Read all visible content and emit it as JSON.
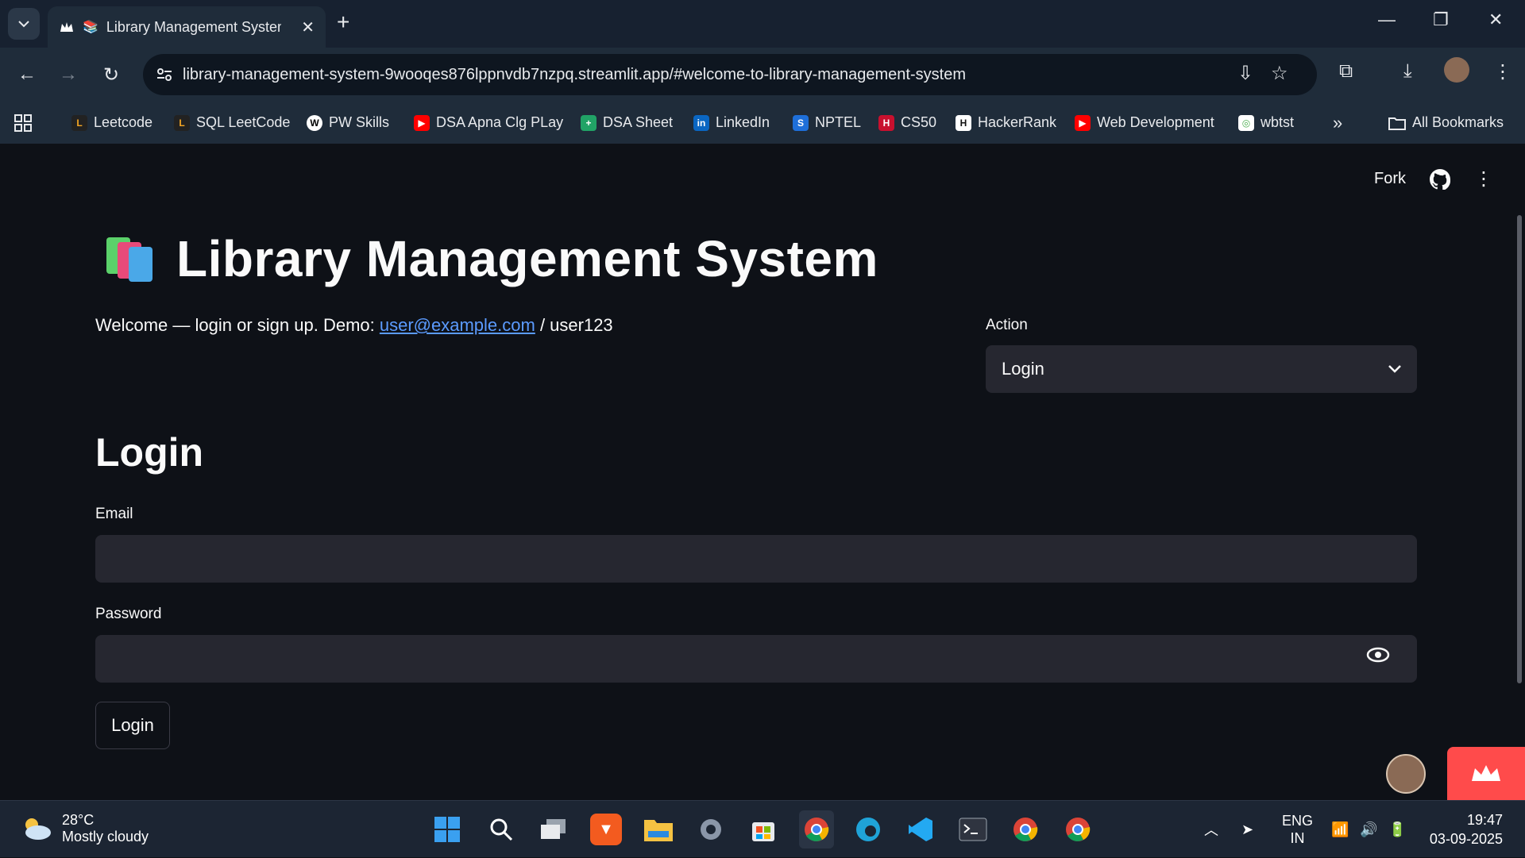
{
  "browser": {
    "tab_title": "Library Management System",
    "new_tab": "+",
    "url": "library-management-system-9wooqes876lppnvdb7nzpq.streamlit.app/#welcome-to-library-management-system"
  },
  "bookmarks": {
    "items": [
      {
        "label": "Leetcode",
        "color": "#f5a623"
      },
      {
        "label": "SQL LeetCode",
        "color": "#f5a623"
      },
      {
        "label": "PW Skills",
        "color": "#ffffff"
      },
      {
        "label": "DSA Apna Clg PLay",
        "color": "#ff0000"
      },
      {
        "label": "DSA Sheet",
        "color": "#21a366"
      },
      {
        "label": "LinkedIn",
        "color": "#0a66c2"
      },
      {
        "label": "NPTEL",
        "color": "#1e6fd9"
      },
      {
        "label": "CS50",
        "color": "#c8102e"
      },
      {
        "label": "HackerRank",
        "color": "#111111"
      },
      {
        "label": "Web Development",
        "color": "#ff0000"
      },
      {
        "label": "wbtst",
        "color": "#4caf50"
      }
    ],
    "more": "»",
    "all_bookmarks": "All Bookmarks"
  },
  "app_header": {
    "fork": "Fork"
  },
  "main": {
    "title": "Library Management System",
    "welcome_prefix": "Welcome — login or sign up. Demo: ",
    "welcome_email": "user@example.com",
    "welcome_suffix": " / user123",
    "action_label": "Action",
    "action_selected": "Login",
    "form_title": "Login",
    "email_label": "Email",
    "password_label": "Password",
    "login_button": "Login"
  },
  "taskbar": {
    "temperature": "28°C",
    "weather": "Mostly cloudy",
    "lang_top": "ENG",
    "lang_bottom": "IN",
    "time": "19:47",
    "date": "03-09-2025"
  },
  "colors": {
    "background": "#0e1117",
    "input": "#262730",
    "accent": "#ff4b4b",
    "link": "#5b9bff"
  }
}
